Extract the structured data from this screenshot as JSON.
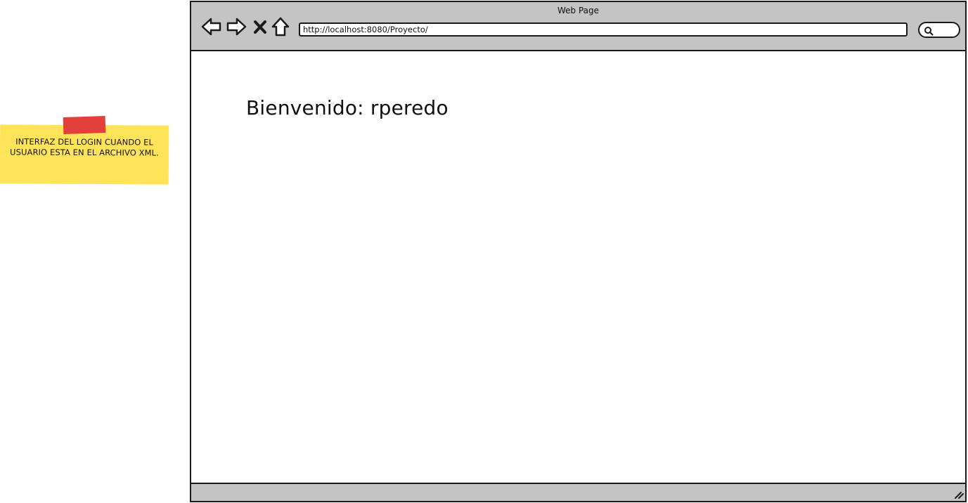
{
  "note": {
    "text": "INTERFAZ DEL LOGIN CUANDO EL USUARIO ESTA EN EL ARCHIVO XML.",
    "color": "#ffe359",
    "tape_color": "#e2403a"
  },
  "browser": {
    "title": "Web Page",
    "url": "http://localhost:8080/Proyecto/",
    "nav_icons": [
      "back-arrow-icon",
      "forward-arrow-icon",
      "close-icon",
      "home-icon"
    ],
    "search_icon": "search-icon",
    "chrome_color": "#c4c4c4"
  },
  "page": {
    "welcome_text": "Bienvenido: rperedo"
  }
}
